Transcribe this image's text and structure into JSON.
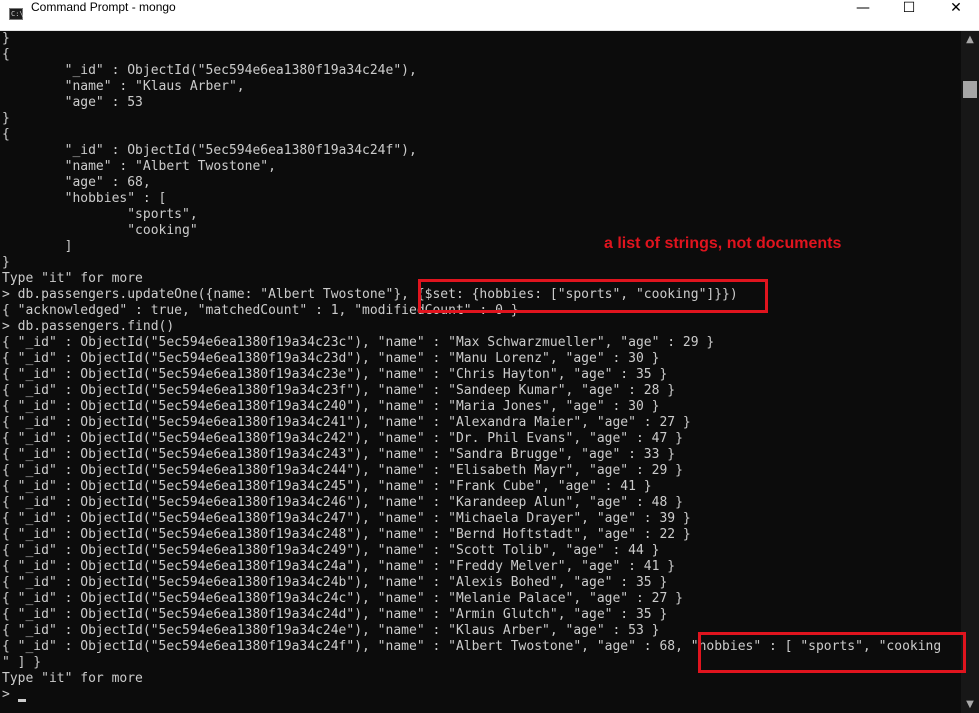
{
  "window": {
    "title": "Command Prompt - mongo",
    "icon_text": "C:\\",
    "minimize": "—",
    "maximize": "☐",
    "close": "✕"
  },
  "console": {
    "lines": [
      "}",
      "{",
      "        \"_id\" : ObjectId(\"5ec594e6ea1380f19a34c24e\"),",
      "        \"name\" : \"Klaus Arber\",",
      "        \"age\" : 53",
      "}",
      "{",
      "        \"_id\" : ObjectId(\"5ec594e6ea1380f19a34c24f\"),",
      "        \"name\" : \"Albert Twostone\",",
      "        \"age\" : 68,",
      "        \"hobbies\" : [",
      "                \"sports\",",
      "                \"cooking\"",
      "        ]",
      "}",
      "Type \"it\" for more",
      "> db.passengers.updateOne({name: \"Albert Twostone\"}, {$set: {hobbies: [\"sports\", \"cooking\"]}})",
      "{ \"acknowledged\" : true, \"matchedCount\" : 1, \"modifiedCount\" : 0 }",
      "> db.passengers.find()",
      "{ \"_id\" : ObjectId(\"5ec594e6ea1380f19a34c23c\"), \"name\" : \"Max Schwarzmueller\", \"age\" : 29 }",
      "{ \"_id\" : ObjectId(\"5ec594e6ea1380f19a34c23d\"), \"name\" : \"Manu Lorenz\", \"age\" : 30 }",
      "{ \"_id\" : ObjectId(\"5ec594e6ea1380f19a34c23e\"), \"name\" : \"Chris Hayton\", \"age\" : 35 }",
      "{ \"_id\" : ObjectId(\"5ec594e6ea1380f19a34c23f\"), \"name\" : \"Sandeep Kumar\", \"age\" : 28 }",
      "{ \"_id\" : ObjectId(\"5ec594e6ea1380f19a34c240\"), \"name\" : \"Maria Jones\", \"age\" : 30 }",
      "{ \"_id\" : ObjectId(\"5ec594e6ea1380f19a34c241\"), \"name\" : \"Alexandra Maier\", \"age\" : 27 }",
      "{ \"_id\" : ObjectId(\"5ec594e6ea1380f19a34c242\"), \"name\" : \"Dr. Phil Evans\", \"age\" : 47 }",
      "{ \"_id\" : ObjectId(\"5ec594e6ea1380f19a34c243\"), \"name\" : \"Sandra Brugge\", \"age\" : 33 }",
      "{ \"_id\" : ObjectId(\"5ec594e6ea1380f19a34c244\"), \"name\" : \"Elisabeth Mayr\", \"age\" : 29 }",
      "{ \"_id\" : ObjectId(\"5ec594e6ea1380f19a34c245\"), \"name\" : \"Frank Cube\", \"age\" : 41 }",
      "{ \"_id\" : ObjectId(\"5ec594e6ea1380f19a34c246\"), \"name\" : \"Karandeep Alun\", \"age\" : 48 }",
      "{ \"_id\" : ObjectId(\"5ec594e6ea1380f19a34c247\"), \"name\" : \"Michaela Drayer\", \"age\" : 39 }",
      "{ \"_id\" : ObjectId(\"5ec594e6ea1380f19a34c248\"), \"name\" : \"Bernd Hoftstadt\", \"age\" : 22 }",
      "{ \"_id\" : ObjectId(\"5ec594e6ea1380f19a34c249\"), \"name\" : \"Scott Tolib\", \"age\" : 44 }",
      "{ \"_id\" : ObjectId(\"5ec594e6ea1380f19a34c24a\"), \"name\" : \"Freddy Melver\", \"age\" : 41 }",
      "{ \"_id\" : ObjectId(\"5ec594e6ea1380f19a34c24b\"), \"name\" : \"Alexis Bohed\", \"age\" : 35 }",
      "{ \"_id\" : ObjectId(\"5ec594e6ea1380f19a34c24c\"), \"name\" : \"Melanie Palace\", \"age\" : 27 }",
      "{ \"_id\" : ObjectId(\"5ec594e6ea1380f19a34c24d\"), \"name\" : \"Armin Glutch\", \"age\" : 35 }",
      "{ \"_id\" : ObjectId(\"5ec594e6ea1380f19a34c24e\"), \"name\" : \"Klaus Arber\", \"age\" : 53 }",
      "{ \"_id\" : ObjectId(\"5ec594e6ea1380f19a34c24f\"), \"name\" : \"Albert Twostone\", \"age\" : 68, \"hobbies\" : [ \"sports\", \"cooking",
      "\" ] }",
      "Type \"it\" for more",
      "> "
    ]
  },
  "annotation": {
    "text": "a list of strings, not documents",
    "color": "#e0141e"
  },
  "scrollbar": {
    "up_arrow": "▲",
    "down_arrow": "▼"
  }
}
